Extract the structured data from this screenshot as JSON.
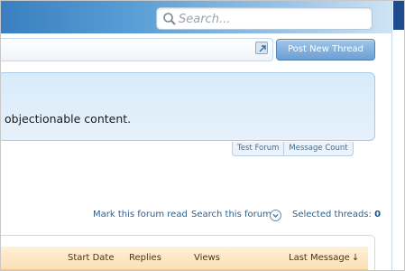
{
  "search": {
    "placeholder": "Search..."
  },
  "header": {
    "post_button_label": "Post New Thread"
  },
  "forum_description": {
    "text": "objectionable content."
  },
  "tabs": [
    {
      "label": "Test Forum"
    },
    {
      "label": "Message Count"
    }
  ],
  "controls": {
    "mark_read_label": "Mark this forum read",
    "search_forum_label": "Search this forum",
    "selected_threads_label": "Selected threads:",
    "selected_threads_count": "0"
  },
  "table": {
    "columns": {
      "start_date": "Start Date",
      "replies": "Replies",
      "views": "Views",
      "last_message": "Last Message",
      "sort_indicator": "↓"
    }
  },
  "icons": {
    "search": "search-icon",
    "external": "external-link-icon",
    "dropdown": "chevron-down-icon"
  },
  "colors": {
    "accent_blue": "#5a9fd6",
    "link_blue": "#2b5f8f",
    "header_dark": "#1e4b8e",
    "table_head": "#fbe0b7"
  }
}
